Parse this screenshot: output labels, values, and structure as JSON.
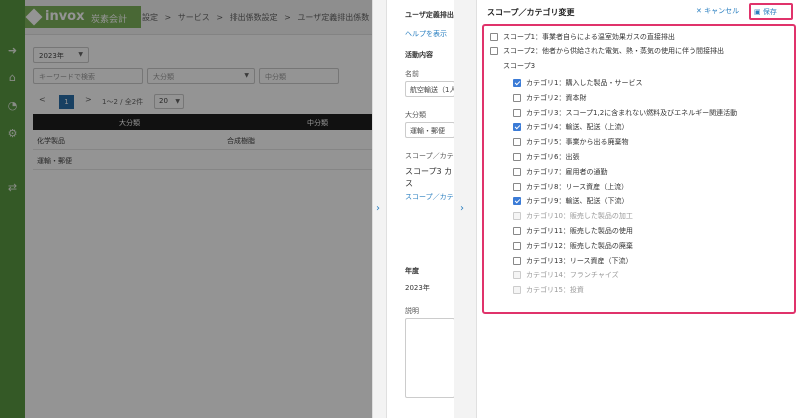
{
  "app": {
    "brand": "invox",
    "brand_sub": "炭素会計"
  },
  "breadcrumb": [
    "設定",
    ">",
    "サービス",
    ">",
    "排出係数設定",
    ">",
    "ユーザ定義排出係数"
  ],
  "filters": {
    "year": "2023年",
    "keyword_placeholder": "キーワードで検索",
    "major_category": "大分類",
    "minor_category": "中分類"
  },
  "pagination": {
    "prev": "<",
    "current": "1",
    "next": ">",
    "summary": "1〜2 / 全2件",
    "page_size": "20"
  },
  "table": {
    "headers": [
      "大分類",
      "中分類"
    ],
    "rows": [
      [
        "化学製品",
        "合成樹脂"
      ],
      [
        "運輸・郵便",
        ""
      ]
    ]
  },
  "middle_panel": {
    "title": "ユーザ定義排出",
    "help": "ヘルプを表示",
    "activity_label": "活動内容",
    "name_label": "名前",
    "name_value": "航空輸送（1人",
    "major_label": "大分類",
    "major_value": "運輸・郵便",
    "scope_label": "スコープ／カテ",
    "scope_value": "スコープ3 カ",
    "scope_value2": "ス",
    "scope_link": "スコープ／カテ",
    "year_label": "年度",
    "year_value": "2023年",
    "desc_label": "説明"
  },
  "panel": {
    "title": "スコープ／カテゴリ変更",
    "cancel": "キャンセル",
    "save": "保存"
  },
  "scopes": {
    "scope1": {
      "label": "スコープ1：事業者自らによる温室効果ガスの直接排出",
      "checked": false
    },
    "scope2": {
      "label": "スコープ2：他者から供給された電気、熱・蒸気の使用に伴う間接排出",
      "checked": false
    },
    "scope3": "スコープ3"
  },
  "categories": [
    {
      "label": "カテゴリ1：購入した製品・サービス",
      "checked": true,
      "disabled": false
    },
    {
      "label": "カテゴリ2：資本財",
      "checked": false,
      "disabled": false
    },
    {
      "label": "カテゴリ3：スコープ1,2に含まれない燃料及びエネルギー関連活動",
      "checked": false,
      "disabled": false
    },
    {
      "label": "カテゴリ4：輸送、配送（上流）",
      "checked": true,
      "disabled": false
    },
    {
      "label": "カテゴリ5：事業から出る廃棄物",
      "checked": false,
      "disabled": false
    },
    {
      "label": "カテゴリ6：出張",
      "checked": false,
      "disabled": false
    },
    {
      "label": "カテゴリ7：雇用者の通勤",
      "checked": false,
      "disabled": false
    },
    {
      "label": "カテゴリ8：リース資産（上流）",
      "checked": false,
      "disabled": false
    },
    {
      "label": "カテゴリ9：輸送、配送（下流）",
      "checked": true,
      "disabled": false
    },
    {
      "label": "カテゴリ10：販売した製品の加工",
      "checked": false,
      "disabled": true
    },
    {
      "label": "カテゴリ11：販売した製品の使用",
      "checked": false,
      "disabled": false
    },
    {
      "label": "カテゴリ12：販売した製品の廃棄",
      "checked": false,
      "disabled": false
    },
    {
      "label": "カテゴリ13：リース資産（下流）",
      "checked": false,
      "disabled": false
    },
    {
      "label": "カテゴリ14：フランチャイズ",
      "checked": false,
      "disabled": true
    },
    {
      "label": "カテゴリ15：投資",
      "checked": false,
      "disabled": true
    }
  ],
  "colors": {
    "sidebar": "#5a9a43",
    "accent": "#2a7fc0",
    "highlight": "#e0336b",
    "checkbox_checked": "#3b7bd6"
  }
}
